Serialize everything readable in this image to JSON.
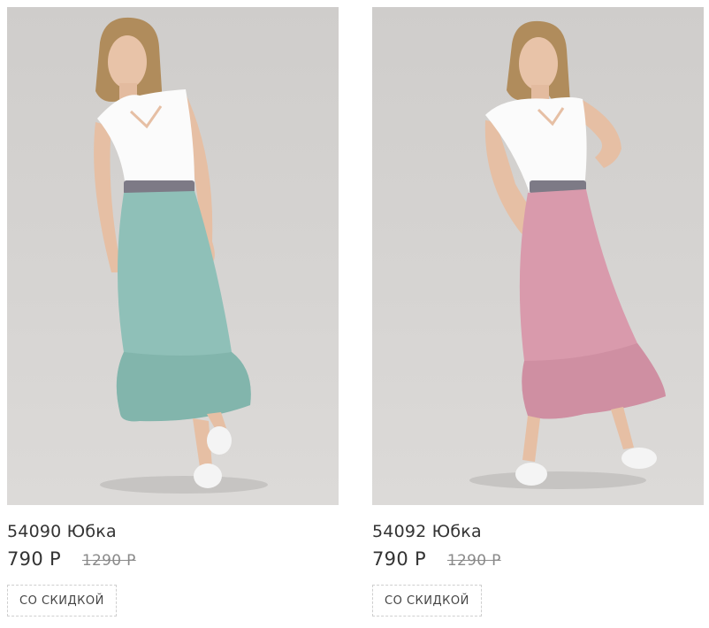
{
  "products": [
    {
      "title": "54090 Юбка",
      "price": "790 Р",
      "old_price": "1290 Р",
      "badge": "СО СКИДКОЙ",
      "skirt_color": "#8fc0b8",
      "skirt_shade": "#78aba3"
    },
    {
      "title": "54092 Юбка",
      "price": "790 Р",
      "old_price": "1290 Р",
      "badge": "СО СКИДКОЙ",
      "skirt_color": "#d99aac",
      "skirt_shade": "#c7879a"
    }
  ]
}
